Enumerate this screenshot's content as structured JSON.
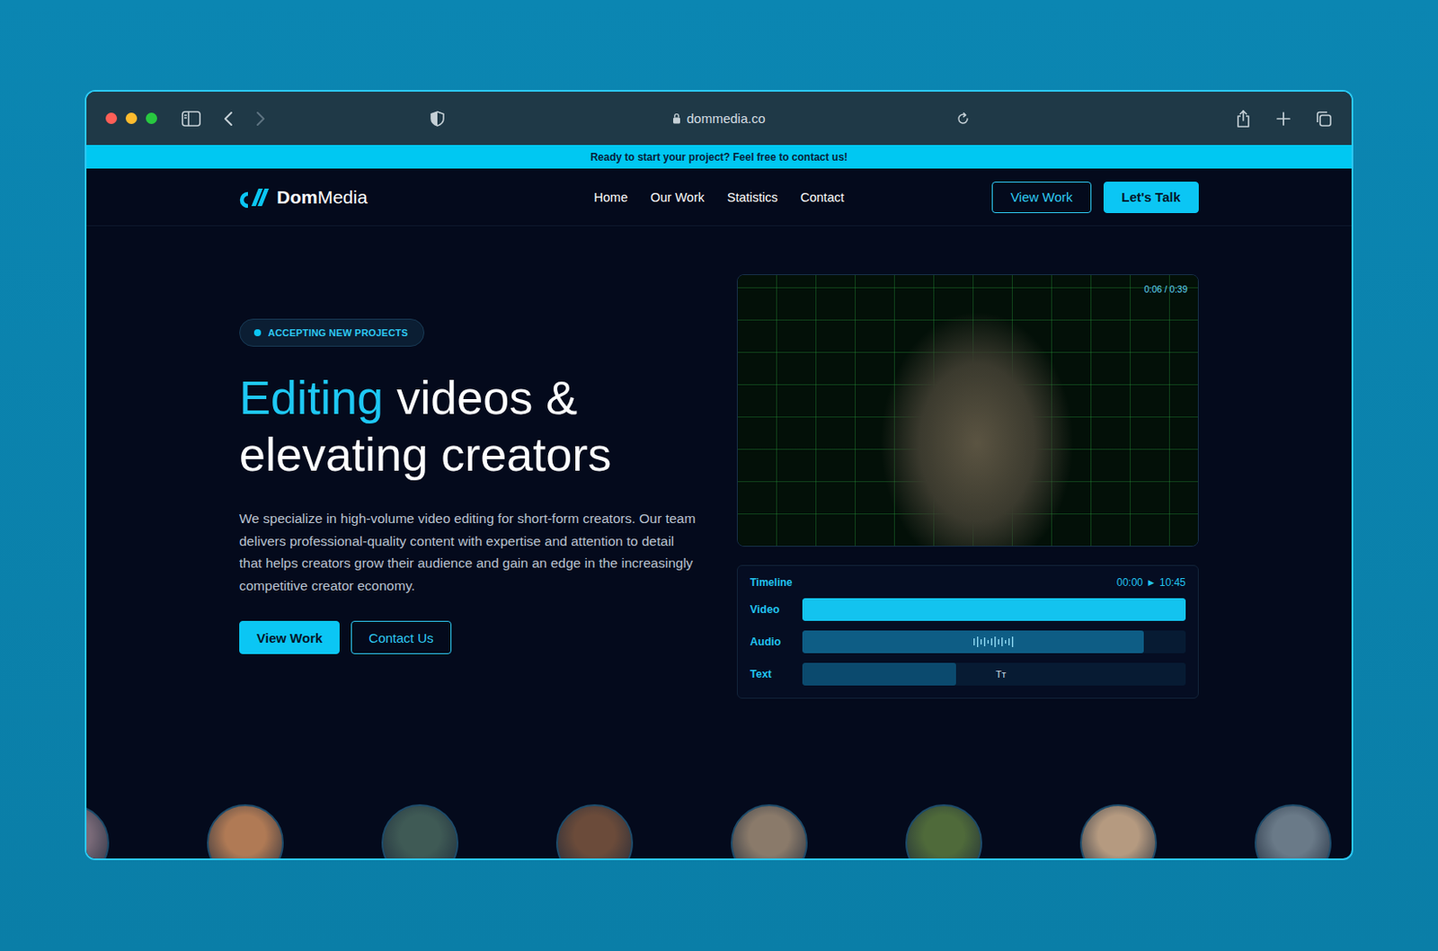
{
  "browser": {
    "url": "dommedia.co",
    "back_enabled": true,
    "forward_enabled": false
  },
  "banner": "Ready to start your project? Feel free to contact us!",
  "logo": {
    "bold": "Dom",
    "regular": "Media"
  },
  "nav": {
    "links": [
      {
        "label": "Home"
      },
      {
        "label": "Our Work"
      },
      {
        "label": "Statistics"
      },
      {
        "label": "Contact"
      }
    ],
    "buttons": [
      {
        "label": "View Work",
        "kind": "outline"
      },
      {
        "label": "Let's Talk",
        "kind": "filled"
      }
    ]
  },
  "hero": {
    "badge": "ACCEPTING NEW PROJECTS",
    "headline": {
      "highlight": "Editing",
      "rest": " videos &",
      "line2": "elevating creators"
    },
    "description": "We specialize in high-volume video editing for short-form creators. Our team delivers professional-quality content with expertise and attention to detail that helps creators grow their audience and gain an edge in the increasingly competitive creator economy.",
    "buttons": [
      {
        "label": "View Work",
        "kind": "filled"
      },
      {
        "label": "Contact Us",
        "kind": "outline"
      }
    ]
  },
  "video": {
    "time": "0:06 / 0:39"
  },
  "timeline": {
    "title": "Timeline",
    "start": "00:00",
    "play": "▶",
    "end": "10:45",
    "tracks": [
      {
        "name": "Video",
        "level": 1.0,
        "kind": "plain",
        "marker": ""
      },
      {
        "name": "Audio",
        "level": 0.89,
        "kind": "audio",
        "marker": ""
      },
      {
        "name": "Text",
        "level": 0.4,
        "kind": "text",
        "marker": "Tт"
      }
    ]
  },
  "creators": [
    {
      "color": "#7a6a78"
    },
    {
      "color": "#b07a55"
    },
    {
      "color": "#3f5a55"
    },
    {
      "color": "#6b4b3a"
    },
    {
      "color": "#8a7a6a"
    },
    {
      "color": "#4f6a3a"
    },
    {
      "color": "#b59a80"
    },
    {
      "color": "#6a7a88"
    }
  ]
}
